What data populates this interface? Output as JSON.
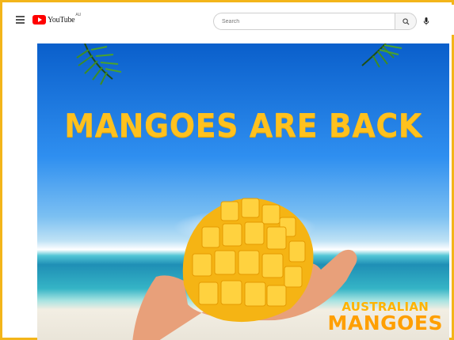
{
  "header": {
    "logo_text": "YouTube",
    "logo_region": "AU",
    "search": {
      "placeholder": "Search",
      "value": ""
    }
  },
  "icons": {
    "menu": "hamburger-menu-icon",
    "search": "search-icon",
    "mic": "microphone-icon",
    "logo": "youtube-play-icon"
  },
  "video": {
    "headline": "MANGOES ARE BACK",
    "brand_line1": "AUSTRALIAN",
    "brand_line2": "MANGOES"
  },
  "colors": {
    "frame_border": "#f3b51a",
    "headline": "#ffc11e",
    "youtube_red": "#ff0000"
  }
}
